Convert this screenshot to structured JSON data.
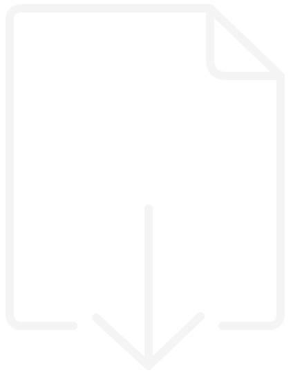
{
  "icon": {
    "name": "file-download-icon",
    "stroke_color": "#f4f4f4",
    "label_color": "#fbfbfb",
    "label": ""
  }
}
